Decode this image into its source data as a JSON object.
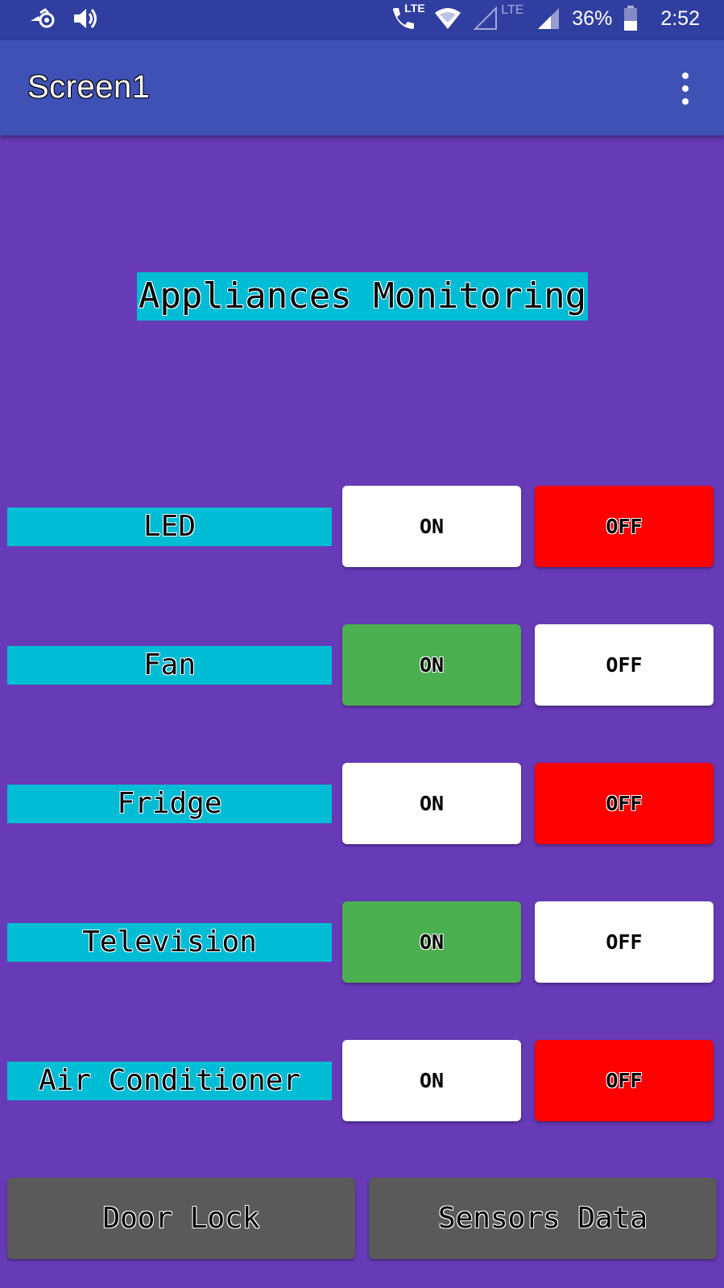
{
  "status_bar": {
    "icons_left": [
      "notification-app-icon",
      "volume-icon"
    ],
    "icons_right": [
      "volte-call-icon",
      "wifi-icon",
      "signal-empty-icon",
      "signal-icon",
      "battery-icon"
    ],
    "lte_label_1": "LTE",
    "lte_label_2": "LTE",
    "battery_percent": "36%",
    "time": "2:52"
  },
  "app_bar": {
    "title": "Screen1",
    "menu_icon": "overflow-menu-icon"
  },
  "heading": "Appliances Monitoring",
  "appliances": [
    {
      "name": "LED",
      "on_label": "ON",
      "off_label": "OFF",
      "active": "off"
    },
    {
      "name": "Fan",
      "on_label": "ON",
      "off_label": "OFF",
      "active": "on"
    },
    {
      "name": "Fridge",
      "on_label": "ON",
      "off_label": "OFF",
      "active": "off"
    },
    {
      "name": "Television",
      "on_label": "ON",
      "off_label": "OFF",
      "active": "on"
    },
    {
      "name": "Air Conditioner",
      "on_label": "ON",
      "off_label": "OFF",
      "active": "off"
    }
  ],
  "bottom_buttons": {
    "door_lock": "Door Lock",
    "sensors_data": "Sensors Data"
  },
  "colors": {
    "background": "#673ab7",
    "app_bar": "#3f51b5",
    "status_bar": "#303f9f",
    "label_bg": "#00bcd4",
    "on_active": "#4caf50",
    "off_active": "#ff0000",
    "inactive": "#ffffff",
    "bottom_button": "#5a5a5a"
  }
}
